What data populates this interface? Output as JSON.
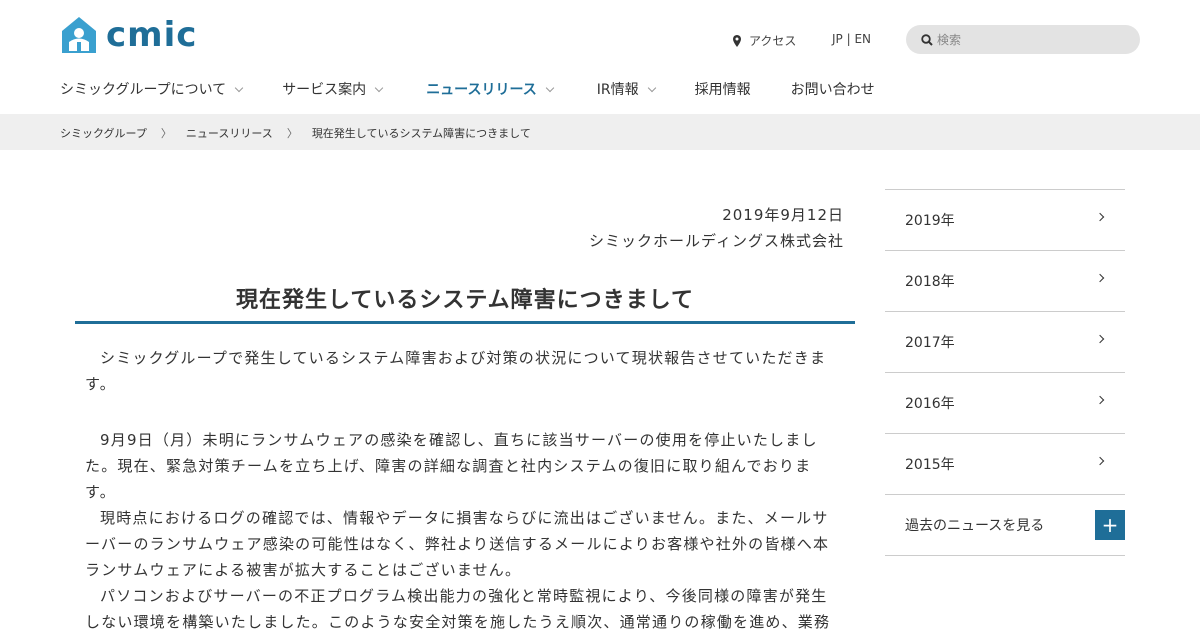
{
  "header": {
    "logo_text": "cmic",
    "access_label": "アクセス",
    "lang_label": "JP | EN",
    "search_placeholder": "検索"
  },
  "nav": {
    "items": [
      {
        "label": "シミックグループについて"
      },
      {
        "label": "サービス案内"
      },
      {
        "label": "ニュースリリース"
      },
      {
        "label": "IR情報"
      },
      {
        "label": "採用情報"
      },
      {
        "label": "お問い合わせ"
      }
    ]
  },
  "breadcrumb": {
    "items": [
      "シミックグループ",
      "ニュースリリース",
      "現在発生しているシステム障害につきまして"
    ]
  },
  "article": {
    "date": "2019年9月12日",
    "company": "シミックホールディングス株式会社",
    "title": "現在発生しているシステム障害につきまして",
    "paragraphs": [
      "シミックグループで発生しているシステム障害および対策の状況について現状報告させていただきます。",
      "9月9日（月）未明にランサムウェアの感染を確認し、直ちに該当サーバーの使用を停止いたしました。現在、緊急対策チームを立ち上げ、障害の詳細な調査と社内システムの復旧に取り組んでおります。",
      "現時点におけるログの確認では、情報やデータに損害ならびに流出はございません。また、メールサーバーのランサムウェア感染の可能性はなく、弊社より送信するメールによりお客様や社外の皆様へ本ランサムウェアによる被害が拡大することはございません。",
      "パソコンおよびサーバーの不正プログラム検出能力の強化と常時監視により、今後同様の障害が発生しない環境を構築いたしました。このような安全対策を施したうえ順次、通常通りの稼働を進め、業務"
    ]
  },
  "sidebar": {
    "years": [
      "2019年",
      "2018年",
      "2017年",
      "2016年",
      "2015年"
    ],
    "past_label": "過去のニュースを見る",
    "plus_symbol": "+"
  },
  "colors": {
    "brand": "#1f6e98",
    "breadcrumb_bg": "#efefef",
    "search_bg": "#e3e3e3"
  }
}
